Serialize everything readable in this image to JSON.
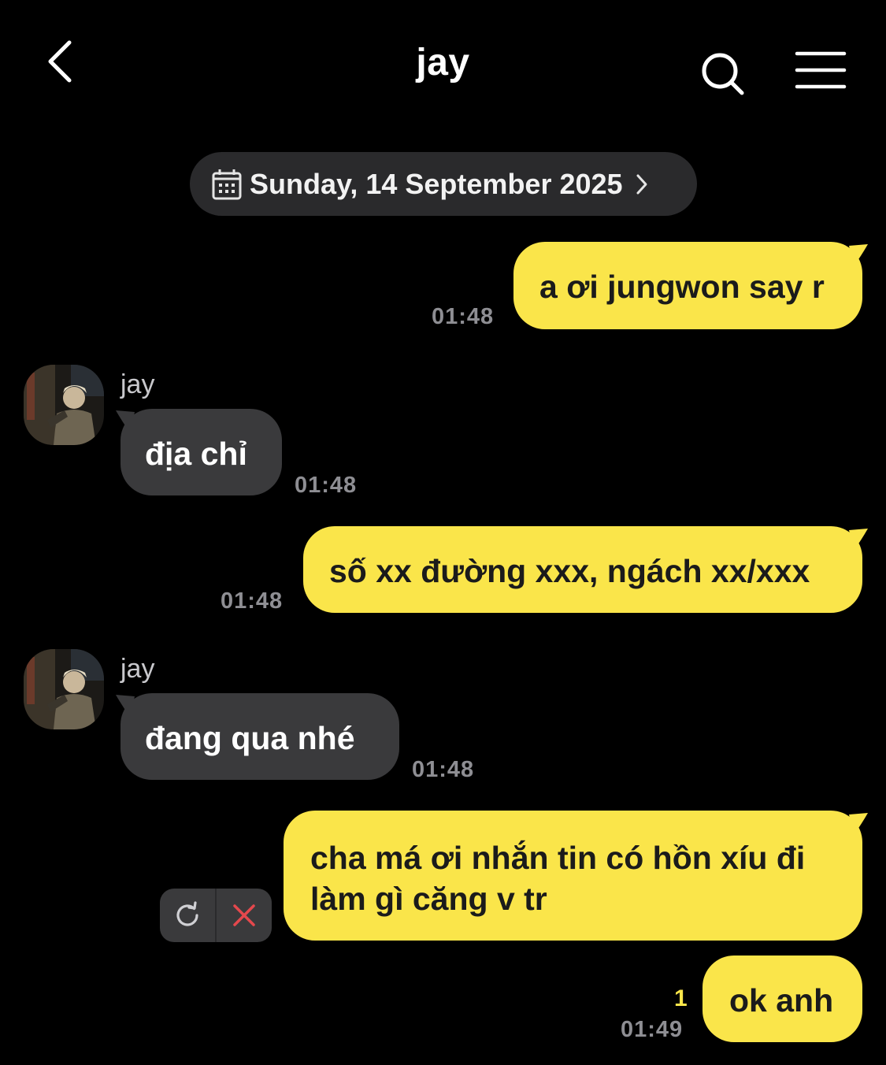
{
  "header": {
    "title": "jay",
    "back_icon": "chevron-left-icon",
    "search_icon": "search-icon",
    "menu_icon": "hamburger-menu-icon"
  },
  "date_divider": {
    "label": "Sunday, 14 September 2025",
    "icon": "calendar-icon"
  },
  "messages": [
    {
      "direction": "outgoing",
      "text": "a ơi jungwon say r",
      "time": "01:48"
    },
    {
      "direction": "incoming",
      "sender": "jay",
      "text": "địa chỉ",
      "time": "01:48"
    },
    {
      "direction": "outgoing",
      "text": "số xx đường xxx, ngách xx/xxx",
      "time": "01:48"
    },
    {
      "direction": "incoming",
      "sender": "jay",
      "text": "đang qua nhé",
      "time": "01:48"
    },
    {
      "direction": "outgoing",
      "status": "failed",
      "text_line1": "cha má ơi nhắn tin có hồn xíu đi",
      "text_line2": "làm gì căng v tr"
    },
    {
      "direction": "outgoing",
      "text": "ok anh",
      "time": "01:49",
      "unread_count": "1"
    }
  ],
  "colors": {
    "background": "#000000",
    "outgoing_bubble": "#fae54a",
    "incoming_bubble": "#3a3a3c",
    "timestamp": "#8e8e93",
    "delete_x": "#e5484d"
  }
}
